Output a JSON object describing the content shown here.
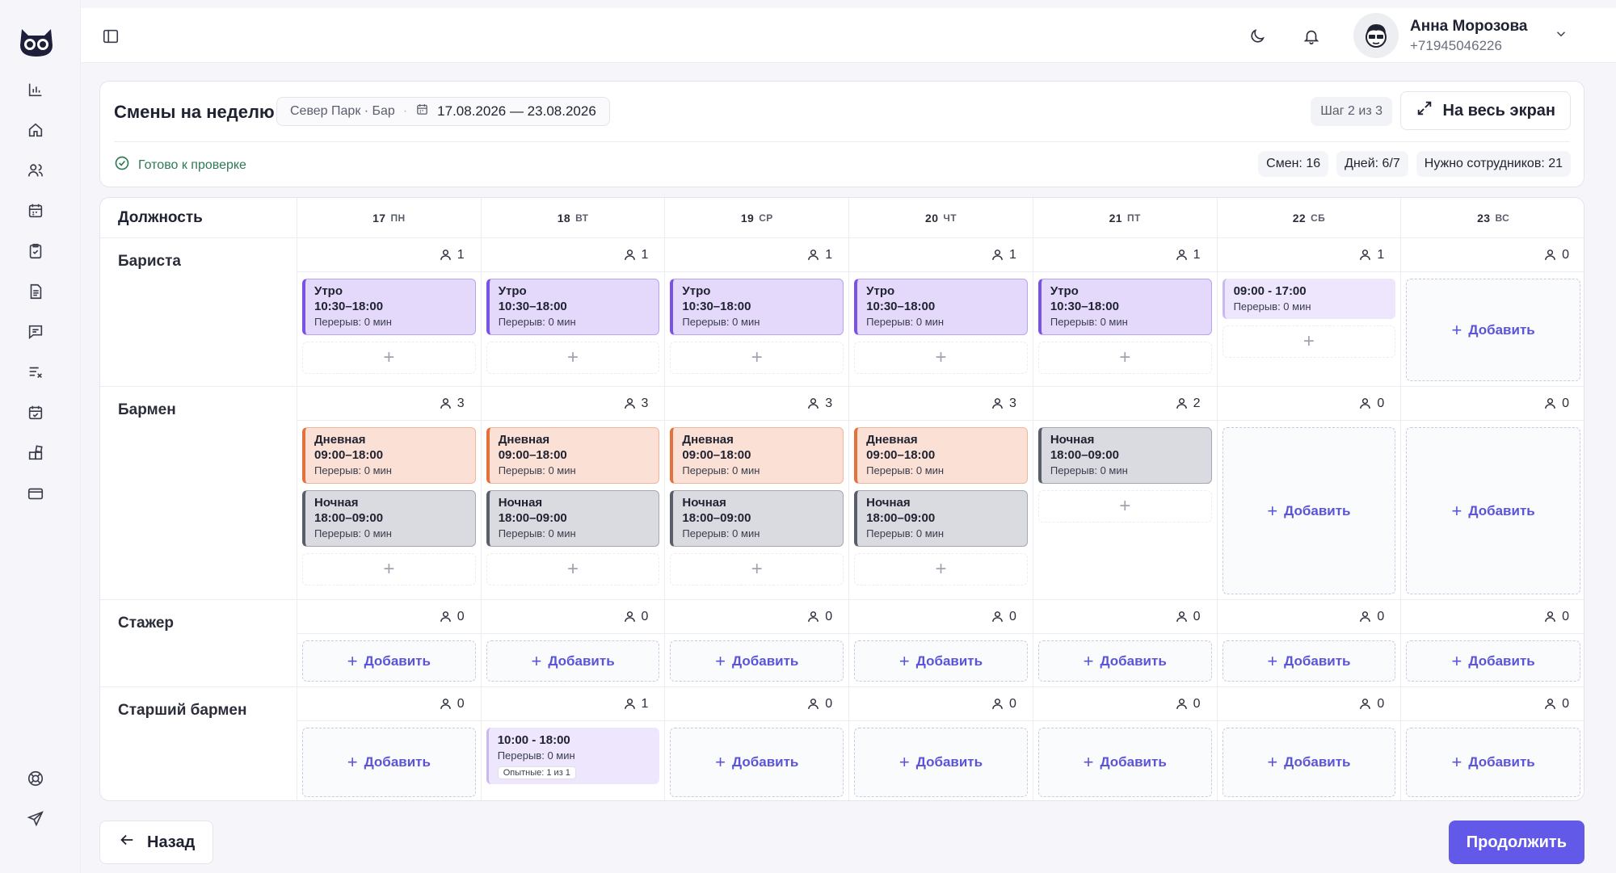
{
  "topbar": {
    "user_name": "Анна Морозова",
    "user_phone": "+71945046226"
  },
  "header": {
    "title": "Смены на неделю",
    "location": "Север Парк · Бар",
    "date_range": "17.08.2026 — 23.08.2026",
    "step": "Шаг 2 из 3",
    "fullscreen_label": "На весь экран",
    "ready_label": "Готово к проверке",
    "stats": {
      "shifts": "Смен: 16",
      "days": "Дней: 6/7",
      "staff": "Нужно сотрудников: 21"
    }
  },
  "grid": {
    "role_header": "Должность",
    "days": [
      {
        "num": "17",
        "dow": "ПН"
      },
      {
        "num": "18",
        "dow": "ВТ"
      },
      {
        "num": "19",
        "dow": "СР"
      },
      {
        "num": "20",
        "dow": "ЧТ"
      },
      {
        "num": "21",
        "dow": "ПТ"
      },
      {
        "num": "22",
        "dow": "СБ"
      },
      {
        "num": "23",
        "dow": "ВС"
      }
    ],
    "add_label": "Добавить",
    "roles": [
      {
        "name": "Бариста",
        "cells": [
          {
            "count": "1",
            "shifts": [
              {
                "kind": "morning",
                "title": "Утро",
                "time": "10:30–18:00",
                "break": "Перерыв: 0 мин"
              }
            ],
            "add": "plus"
          },
          {
            "count": "1",
            "shifts": [
              {
                "kind": "morning",
                "title": "Утро",
                "time": "10:30–18:00",
                "break": "Перерыв: 0 мин"
              }
            ],
            "add": "plus"
          },
          {
            "count": "1",
            "shifts": [
              {
                "kind": "morning",
                "title": "Утро",
                "time": "10:30–18:00",
                "break": "Перерыв: 0 мин"
              }
            ],
            "add": "plus"
          },
          {
            "count": "1",
            "shifts": [
              {
                "kind": "morning",
                "title": "Утро",
                "time": "10:30–18:00",
                "break": "Перерыв: 0 мин"
              }
            ],
            "add": "plus"
          },
          {
            "count": "1",
            "shifts": [
              {
                "kind": "morning",
                "title": "Утро",
                "time": "10:30–18:00",
                "break": "Перерыв: 0 мин"
              }
            ],
            "add": "plus"
          },
          {
            "count": "1",
            "shifts": [
              {
                "kind": "custom",
                "title": "",
                "time": "09:00 - 17:00",
                "break": "Перерыв: 0 мин"
              }
            ],
            "add": "plus"
          },
          {
            "count": "0",
            "shifts": [],
            "add": "box"
          }
        ]
      },
      {
        "name": "Бармен",
        "cells": [
          {
            "count": "3",
            "shifts": [
              {
                "kind": "day",
                "title": "Дневная",
                "time": "09:00–18:00",
                "break": "Перерыв: 0 мин"
              },
              {
                "kind": "night",
                "title": "Ночная",
                "time": "18:00–09:00",
                "break": "Перерыв: 0 мин"
              }
            ],
            "add": "plus"
          },
          {
            "count": "3",
            "shifts": [
              {
                "kind": "day",
                "title": "Дневная",
                "time": "09:00–18:00",
                "break": "Перерыв: 0 мин"
              },
              {
                "kind": "night",
                "title": "Ночная",
                "time": "18:00–09:00",
                "break": "Перерыв: 0 мин"
              }
            ],
            "add": "plus"
          },
          {
            "count": "3",
            "shifts": [
              {
                "kind": "day",
                "title": "Дневная",
                "time": "09:00–18:00",
                "break": "Перерыв: 0 мин"
              },
              {
                "kind": "night",
                "title": "Ночная",
                "time": "18:00–09:00",
                "break": "Перерыв: 0 мин"
              }
            ],
            "add": "plus"
          },
          {
            "count": "3",
            "shifts": [
              {
                "kind": "day",
                "title": "Дневная",
                "time": "09:00–18:00",
                "break": "Перерыв: 0 мин"
              },
              {
                "kind": "night",
                "title": "Ночная",
                "time": "18:00–09:00",
                "break": "Перерыв: 0 мин"
              }
            ],
            "add": "plus"
          },
          {
            "count": "2",
            "shifts": [
              {
                "kind": "night",
                "title": "Ночная",
                "time": "18:00–09:00",
                "break": "Перерыв: 0 мин"
              }
            ],
            "add": "plus"
          },
          {
            "count": "0",
            "shifts": [],
            "add": "box"
          },
          {
            "count": "0",
            "shifts": [],
            "add": "box"
          }
        ]
      },
      {
        "name": "Стажер",
        "cells": [
          {
            "count": "0",
            "shifts": [],
            "add": "box"
          },
          {
            "count": "0",
            "shifts": [],
            "add": "box"
          },
          {
            "count": "0",
            "shifts": [],
            "add": "box"
          },
          {
            "count": "0",
            "shifts": [],
            "add": "box"
          },
          {
            "count": "0",
            "shifts": [],
            "add": "box"
          },
          {
            "count": "0",
            "shifts": [],
            "add": "box"
          },
          {
            "count": "0",
            "shifts": [],
            "add": "box"
          }
        ]
      },
      {
        "name": "Старший бармен",
        "cells": [
          {
            "count": "0",
            "shifts": [],
            "add": "box"
          },
          {
            "count": "1",
            "shifts": [
              {
                "kind": "custom",
                "title": "",
                "time": "10:00 - 18:00",
                "break": "Перерыв: 0 мин",
                "badge": "Опытные: 1 из 1"
              }
            ],
            "add": "none"
          },
          {
            "count": "0",
            "shifts": [],
            "add": "box"
          },
          {
            "count": "0",
            "shifts": [],
            "add": "box"
          },
          {
            "count": "0",
            "shifts": [],
            "add": "box"
          },
          {
            "count": "0",
            "shifts": [],
            "add": "box"
          },
          {
            "count": "0",
            "shifts": [],
            "add": "box"
          }
        ]
      }
    ]
  },
  "footer": {
    "back_label": "Назад",
    "continue_label": "Продолжить"
  },
  "icons": {
    "rail": [
      "chart-icon",
      "home-icon",
      "users-icon",
      "calendar-icon",
      "clipboard-check-icon",
      "document-icon",
      "chat-icon",
      "list-clear-icon",
      "calendar-check-icon",
      "blocks-icon",
      "card-icon",
      "support-icon",
      "send-icon"
    ]
  },
  "colors": {
    "accent": "#6259e8",
    "morning": "#7b52e6",
    "day": "#e4703c",
    "night": "#5a5e6b",
    "ready": "#2f7a55"
  }
}
